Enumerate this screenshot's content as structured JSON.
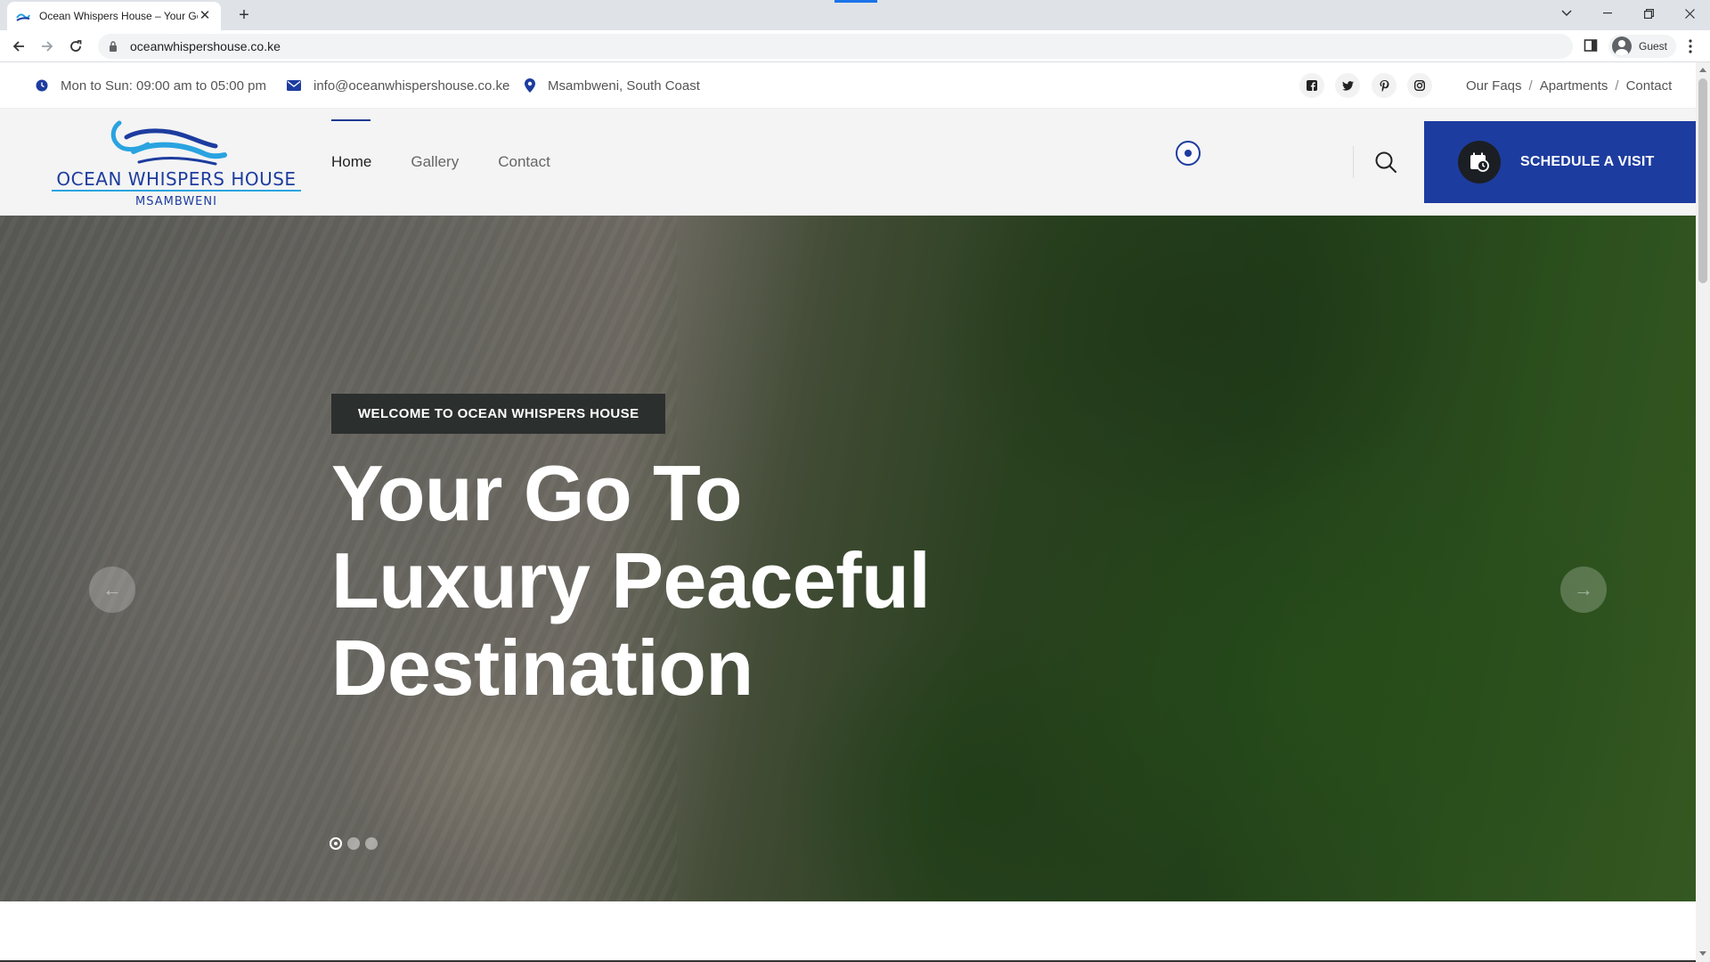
{
  "browser": {
    "tab_title": "Ocean Whispers House – Your Go To",
    "url": "oceanwhispershouse.co.ke",
    "profile_label": "Guest",
    "new_tab_symbol": "+"
  },
  "topbar": {
    "hours": "Mon to Sun: 09:00 am to 05:00 pm",
    "email": "info@oceanwhispershouse.co.ke",
    "location": "Msambweni, South Coast",
    "social": [
      "facebook-icon",
      "twitter-icon",
      "pinterest-icon",
      "instagram-icon"
    ],
    "links": [
      "Our Faqs",
      "Apartments",
      "Contact"
    ],
    "link_separator": "/"
  },
  "header": {
    "logo_title": "OCEAN WHISPERS HOUSE",
    "logo_subtitle": "MSAMBWENI",
    "nav": [
      "Home",
      "Gallery",
      "Contact"
    ],
    "active_nav": "Home",
    "cta_label": "SCHEDULE A VISIT"
  },
  "hero": {
    "eyebrow": "WELCOME TO OCEAN WHISPERS HOUSE",
    "headline_lines": [
      "Your Go To",
      "Luxury Peaceful",
      "Destination"
    ],
    "prev_arrow": "←",
    "next_arrow": "→",
    "slide_count": 3,
    "active_slide": 1
  },
  "colors": {
    "brand_blue": "#1d3c9f",
    "logo_light_blue": "#2aa3e0",
    "dark": "#2b2f2e"
  }
}
